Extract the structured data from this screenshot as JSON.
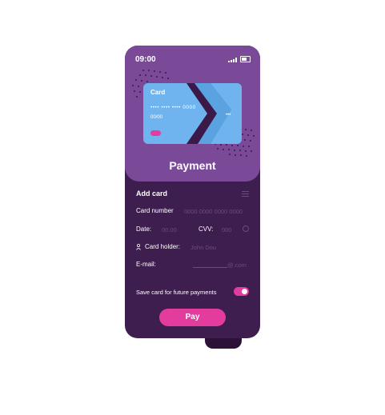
{
  "status_bar": {
    "time": "09:00"
  },
  "card": {
    "title": "Card",
    "number": "•••• •••• •••• 0000",
    "expiry": "00/00",
    "cvv": "•••"
  },
  "header": {
    "title": "Payment"
  },
  "form": {
    "section_title": "Add card",
    "card_number_label": "Card number",
    "card_number_placeholder": "0000 0000 0000 0000",
    "date_label": "Date:",
    "date_placeholder": "00.00",
    "cvv_label": "CVV:",
    "cvv_placeholder": "000",
    "holder_label": "Card holder:",
    "holder_placeholder": "John Dou",
    "email_label": "E-mail:",
    "email_placeholder": "@.com",
    "save_label": "Save card for future payments",
    "save_enabled": true
  },
  "actions": {
    "pay_label": "Pay"
  },
  "colors": {
    "accent": "#e33b9e",
    "header_bg": "#7a4a98",
    "body_bg": "#3e1e4e",
    "card_bg": "#6fb4ee"
  }
}
